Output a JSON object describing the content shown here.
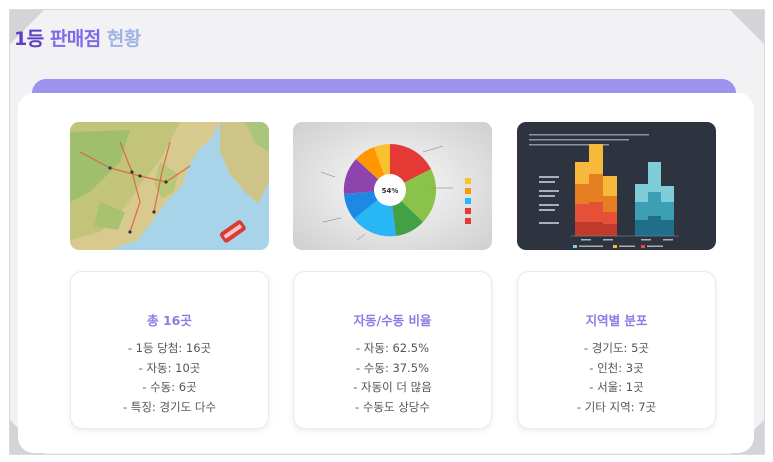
{
  "title": {
    "part1": "1등 ",
    "part2": "판매점 ",
    "part3": "현황"
  },
  "colors": {
    "accent_bar": "#9d93ef",
    "card_title": "#8f7be6",
    "title_dark": "#5b3fc4"
  },
  "images": {
    "map": {
      "icon": "korea-map-image"
    },
    "pie": {
      "icon": "pie-chart-image",
      "center_label": "54%"
    },
    "bar": {
      "icon": "stacked-bar-chart-image"
    }
  },
  "cards": [
    {
      "title": "총 16곳",
      "items": [
        "- 1등 당첨: 16곳",
        "- 자동: 10곳",
        "- 수동: 6곳",
        "- 특징: 경기도 다수"
      ]
    },
    {
      "title": "자동/수동 비율",
      "items": [
        "- 자동: 62.5%",
        "- 수동: 37.5%",
        "- 자동이 더 많음",
        "- 수동도 상당수"
      ]
    },
    {
      "title": "지역별 분포",
      "items": [
        "- 경기도: 5곳",
        "- 인천: 3곳",
        "- 서울: 1곳",
        "- 기타 지역: 7곳"
      ]
    }
  ]
}
